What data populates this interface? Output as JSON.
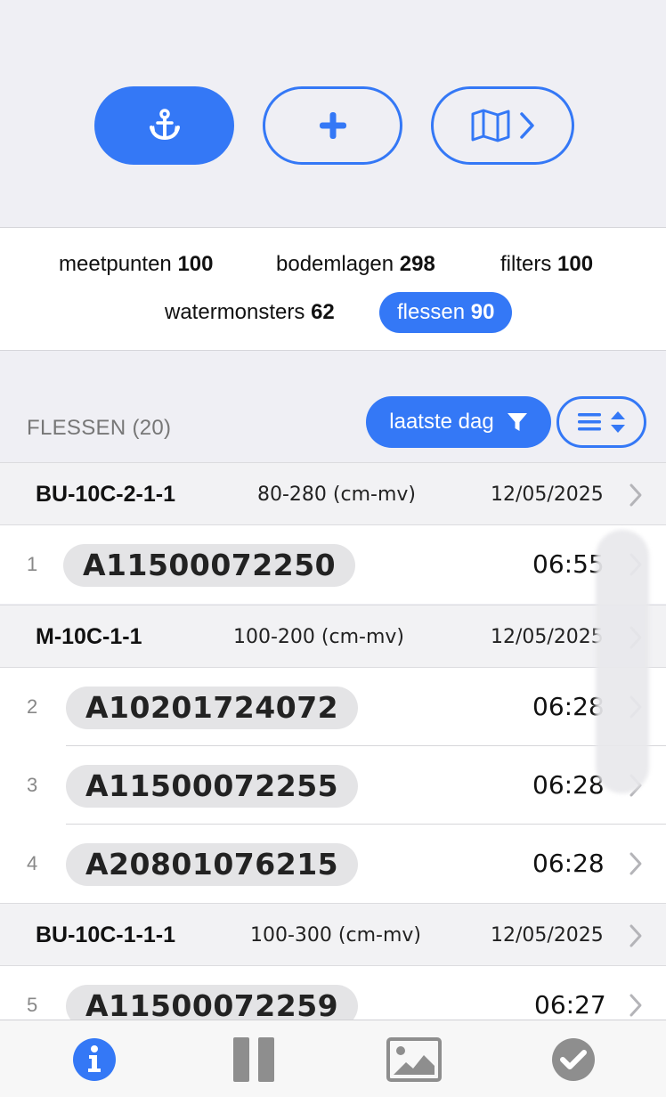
{
  "toolbar": {
    "anchor_icon": "anchor-icon",
    "add_icon": "plus-icon",
    "map_icon": "map-icon",
    "chevron_icon": "chevron-right-icon"
  },
  "counts": [
    {
      "label": "meetpunten",
      "value": "100"
    },
    {
      "label": "bodemlagen",
      "value": "298"
    },
    {
      "label": "filters",
      "value": "100"
    },
    {
      "label": "watermonsters",
      "value": "62"
    },
    {
      "label": "flessen",
      "value": "90",
      "active": true
    }
  ],
  "section": {
    "title": "FLESSEN (20)",
    "filter_label": "laatste dag",
    "filter_icon": "funnel-icon",
    "sort_icon": "sort-icon"
  },
  "groups": [
    {
      "name": "BU-10C-2-1-1",
      "depth": "80-280 (cm-mv)",
      "date": "12/05/2025",
      "items": [
        {
          "index": "1",
          "code": "A11500072250",
          "time": "06:55"
        }
      ]
    },
    {
      "name": "M-10C-1-1",
      "depth": "100-200 (cm-mv)",
      "date": "12/05/2025",
      "items": [
        {
          "index": "2",
          "code": "A10201724072",
          "time": "06:28"
        },
        {
          "index": "3",
          "code": "A11500072255",
          "time": "06:28"
        },
        {
          "index": "4",
          "code": "A20801076215",
          "time": "06:28"
        }
      ]
    },
    {
      "name": "BU-10C-1-1-1",
      "depth": "100-300 (cm-mv)",
      "date": "12/05/2025",
      "items": [
        {
          "index": "5",
          "code": "A11500072259",
          "time": "06:27"
        }
      ]
    }
  ],
  "tabbar": [
    {
      "icon": "info-icon",
      "active": true
    },
    {
      "icon": "pause-icon"
    },
    {
      "icon": "image-icon"
    },
    {
      "icon": "checkmark-icon"
    }
  ],
  "colors": {
    "accent": "#3478f6",
    "background": "#efeff4",
    "chip": "#e4e4e6",
    "inactive_icon": "#8e8e8e"
  }
}
